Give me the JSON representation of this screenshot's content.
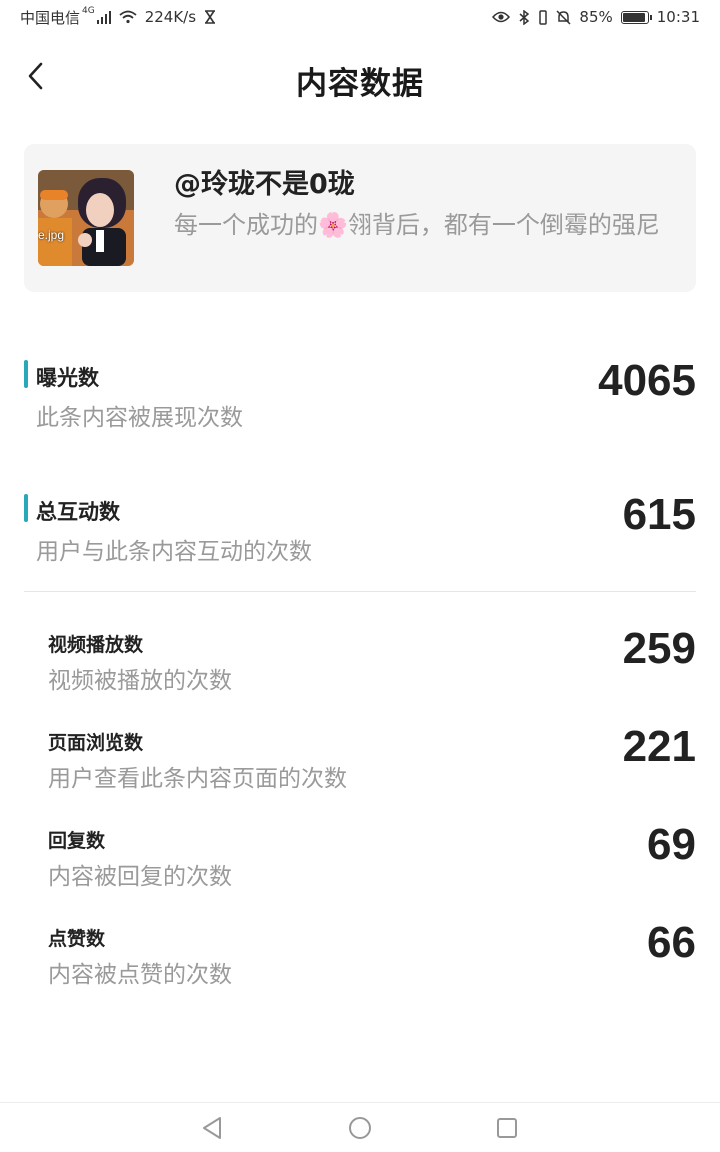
{
  "status_bar": {
    "carrier": "中国电信",
    "network": "4G",
    "speed": "224K/s",
    "battery": "85%",
    "time": "10:31"
  },
  "header": {
    "title": "内容数据"
  },
  "post": {
    "author": "@玲珑不是0珑",
    "text": "每一个成功的🌸翎背后，都有一个倒霉的强尼",
    "thumbnail_caption": "e.jpg"
  },
  "metrics": [
    {
      "label": "曝光数",
      "description": "此条内容被展现次数",
      "value": "4065"
    },
    {
      "label": "总互动数",
      "description": "用户与此条内容互动的次数",
      "value": "615"
    }
  ],
  "sub_metrics": [
    {
      "label": "视频播放数",
      "description": "视频被播放的次数",
      "value": "259"
    },
    {
      "label": "页面浏览数",
      "description": "用户查看此条内容页面的次数",
      "value": "221"
    },
    {
      "label": "回复数",
      "description": "内容被回复的次数",
      "value": "69"
    },
    {
      "label": "点赞数",
      "description": "内容被点赞的次数",
      "value": "66"
    }
  ],
  "colors": {
    "accent": "#29a8b8",
    "card_background": "#f5f5f5",
    "secondary_text": "#9a9a9a"
  }
}
